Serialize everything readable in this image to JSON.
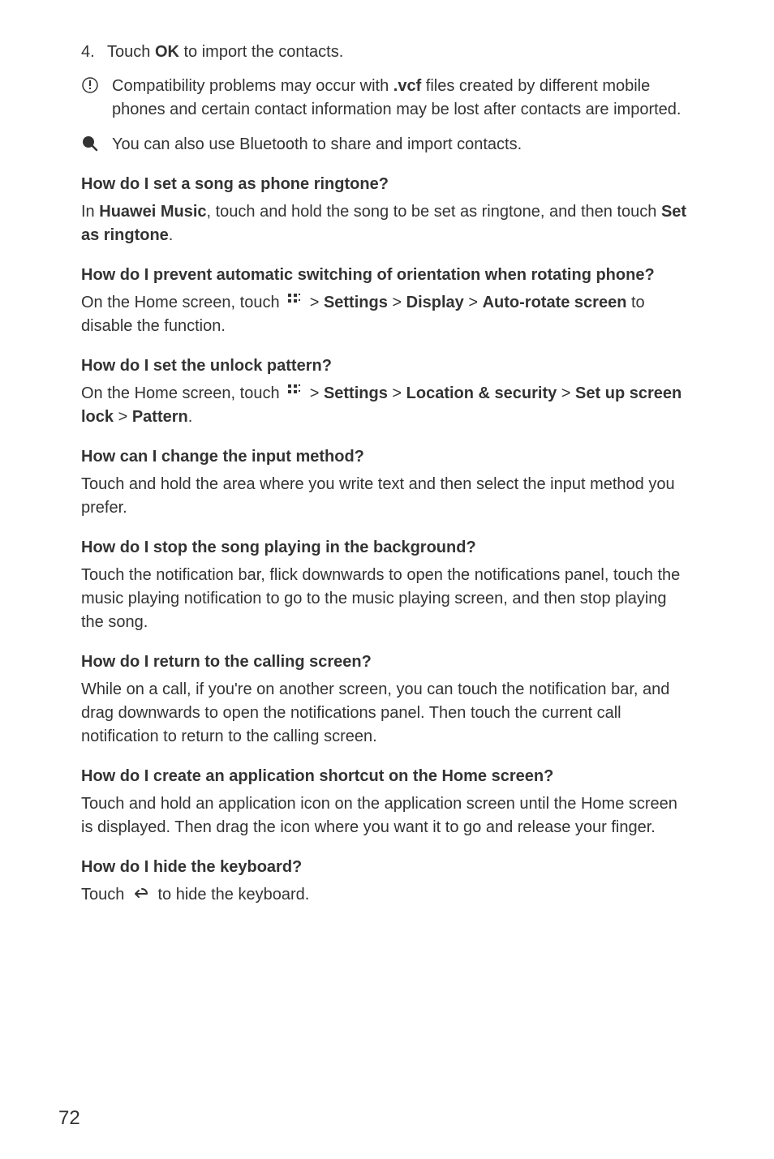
{
  "step4": {
    "number": "4.",
    "pre": "Touch ",
    "bold": "OK",
    "post": " to import the contacts."
  },
  "warningCallout": {
    "pre": "Compatibility problems may occur with ",
    "bold": ".vcf",
    "post": " files created by different mobile phones and certain contact information may be lost after contacts are imported."
  },
  "tipCallout": "You can also use Bluetooth to share and import contacts.",
  "sections": {
    "ringtone": {
      "heading": "How do I set a song as phone ringtone?",
      "body": {
        "pre": "In ",
        "bold1": "Huawei Music",
        "mid": ", touch and hold the song to be set as ringtone, and then touch ",
        "bold2": "Set as ringtone",
        "post": "."
      }
    },
    "orientation": {
      "heading": "How do I prevent automatic switching of orientation when rotating phone?",
      "body": {
        "pre": "On the Home screen, touch ",
        "mid1": " > ",
        "bold1": "Settings",
        "mid2": " > ",
        "bold2": "Display",
        "mid3": " > ",
        "bold3": "Auto-rotate screen",
        "post": " to disable the function."
      }
    },
    "unlockPattern": {
      "heading": "How do I set the unlock pattern?",
      "body": {
        "pre": "On the Home screen, touch ",
        "mid1": " > ",
        "bold1": "Settings",
        "mid2": " > ",
        "bold2": "Location & security",
        "mid3": " > ",
        "bold3": "Set up screen lock",
        "mid4": " > ",
        "bold4": "Pattern",
        "post": "."
      }
    },
    "inputMethod": {
      "heading": "How can I change the input method?",
      "body": "Touch and hold the area where you write text and then select the input method you prefer."
    },
    "stopSong": {
      "heading": "How do I stop the song playing in the background?",
      "body": "Touch the notification bar, flick downwards to open the notifications panel, touch the music playing notification to go to the music playing screen, and then stop playing the song."
    },
    "callingScreen": {
      "heading": "How do I return to the calling screen?",
      "body": "While on a call, if you're on another screen, you can touch the notification bar, and drag downwards to open the notifications panel. Then touch the current call notification to return to the calling screen."
    },
    "shortcut": {
      "heading": "How do I create an application shortcut on the Home screen?",
      "body": "Touch and hold an application icon on the application screen until the Home screen is displayed. Then drag the icon where you want it to go and release your finger."
    },
    "hideKeyboard": {
      "heading": "How do I hide the keyboard?",
      "body": {
        "pre": "Touch ",
        "post": " to hide the keyboard."
      }
    }
  },
  "pageNumber": "72"
}
